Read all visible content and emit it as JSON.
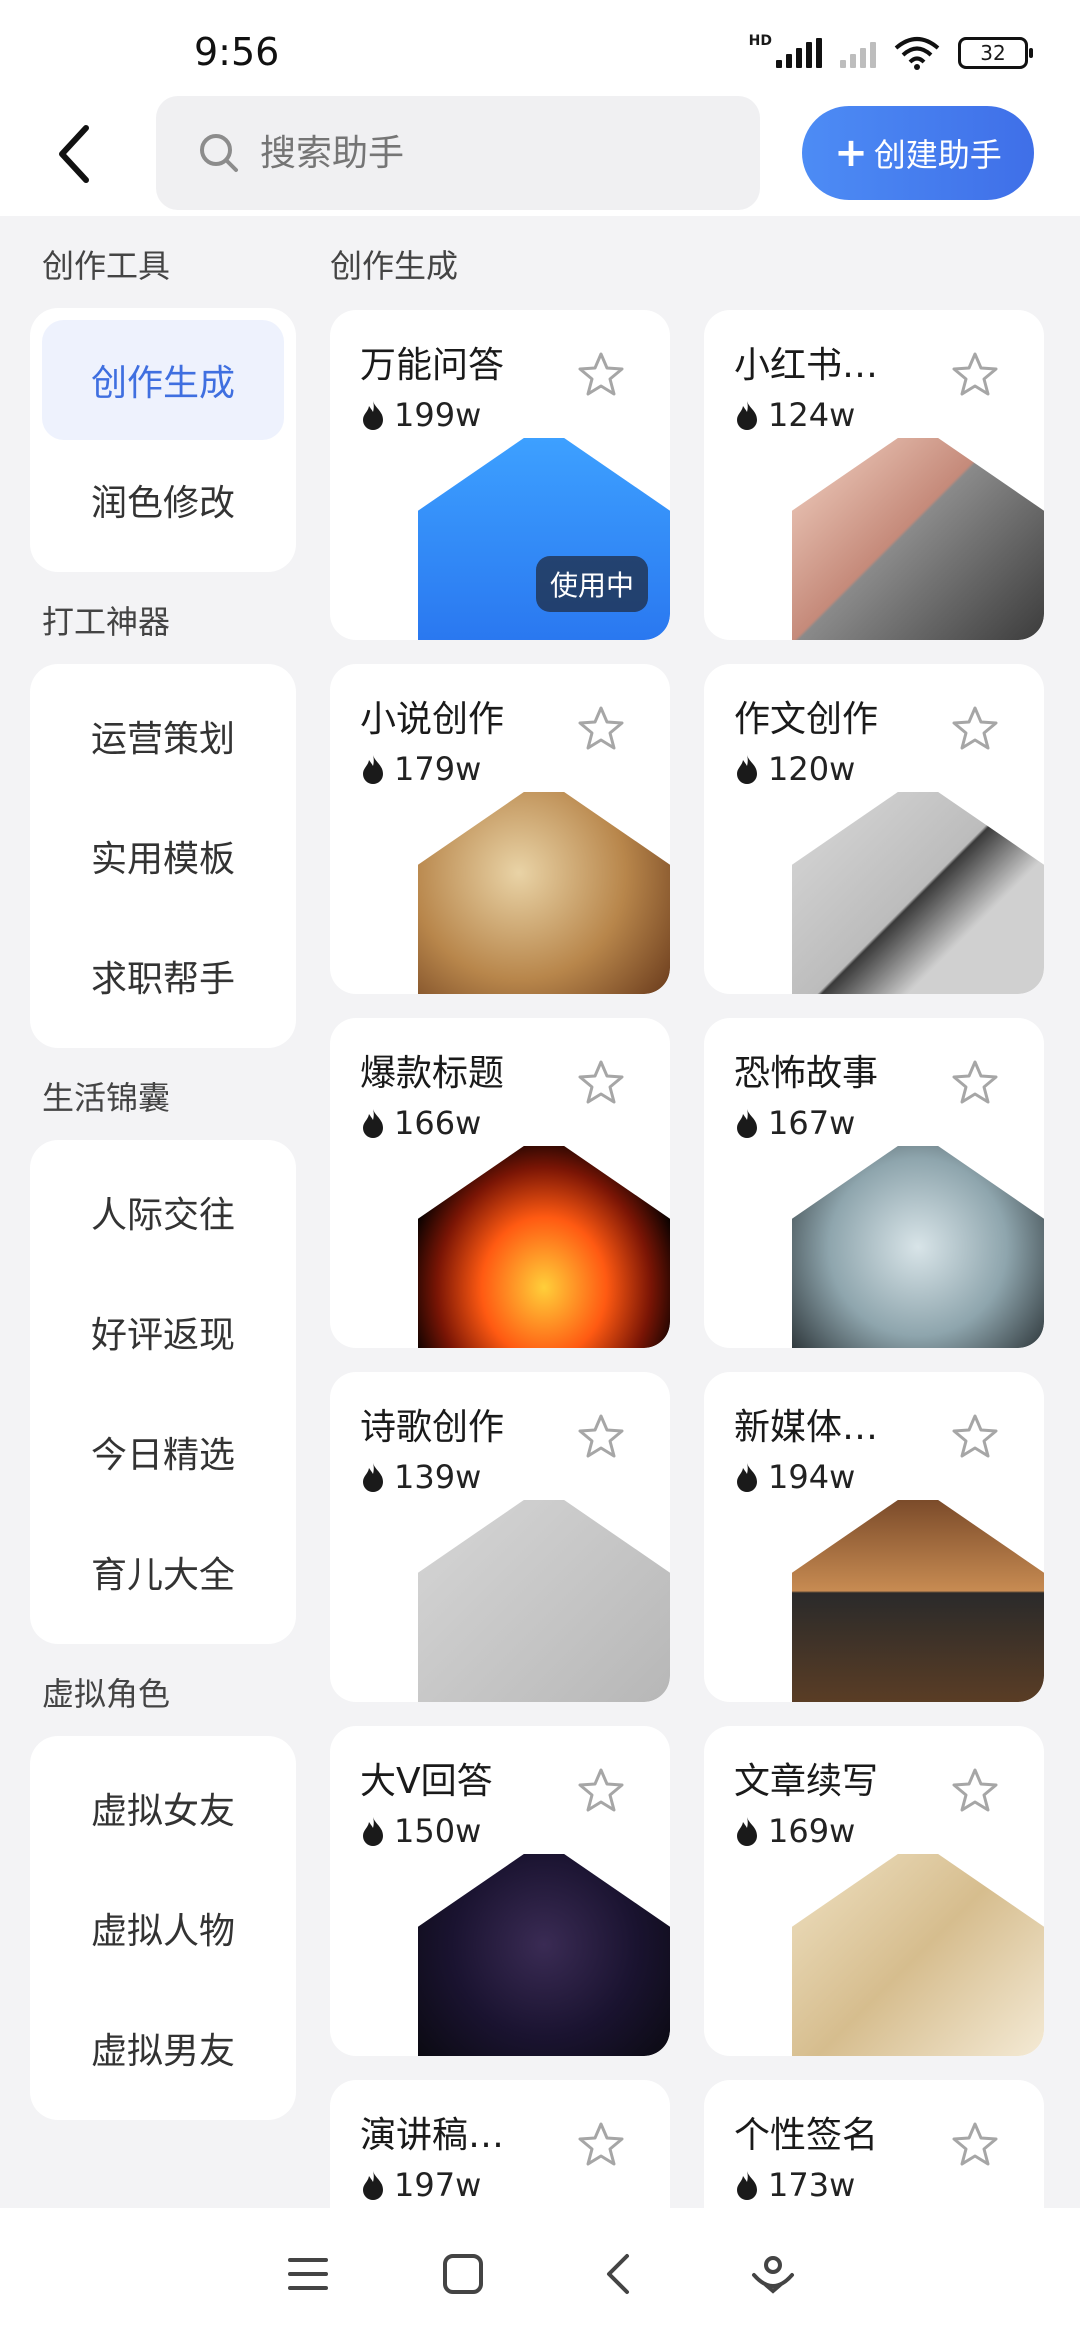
{
  "status_bar": {
    "time": "9:56",
    "network_label": "HD",
    "battery": "32"
  },
  "top_bar": {
    "search_placeholder": "搜索助手",
    "create_button": "创建助手",
    "create_plus": "+"
  },
  "sidebar": {
    "groups": [
      {
        "title": "创作工具",
        "items": [
          "创作生成",
          "润色修改"
        ]
      },
      {
        "title": "打工神器",
        "items": [
          "运营策划",
          "实用模板",
          "求职帮手"
        ]
      },
      {
        "title": "生活锦囊",
        "items": [
          "人际交往",
          "好评返现",
          "今日精选",
          "育儿大全"
        ]
      },
      {
        "title": "虚拟角色",
        "items": [
          "虚拟女友",
          "虚拟人物",
          "虚拟男友"
        ]
      }
    ],
    "active_item": "创作生成"
  },
  "main": {
    "section_title": "创作生成",
    "cards": [
      {
        "title": "万能问答",
        "count": "199w",
        "badge": "使用中"
      },
      {
        "title": "小红书…",
        "count": "124w"
      },
      {
        "title": "小说创作",
        "count": "179w"
      },
      {
        "title": "作文创作",
        "count": "120w"
      },
      {
        "title": "爆款标题",
        "count": "166w"
      },
      {
        "title": "恐怖故事",
        "count": "167w"
      },
      {
        "title": "诗歌创作",
        "count": "139w"
      },
      {
        "title": "新媒体…",
        "count": "194w"
      },
      {
        "title": "大V回答",
        "count": "150w"
      },
      {
        "title": "文章续写",
        "count": "169w"
      },
      {
        "title": "演讲稿…",
        "count": "197w"
      },
      {
        "title": "个性签名",
        "count": "173w"
      }
    ]
  },
  "colors": {
    "accent": "#3f6fe0",
    "button_gradient_start": "#4d8cf5",
    "button_gradient_end": "#3f6fe8",
    "background": "#f3f3f5"
  },
  "icons": [
    "back-icon",
    "search-icon",
    "star-icon",
    "flame-icon",
    "menu-icon",
    "home-icon",
    "nav-back-icon",
    "assistant-icon"
  ]
}
